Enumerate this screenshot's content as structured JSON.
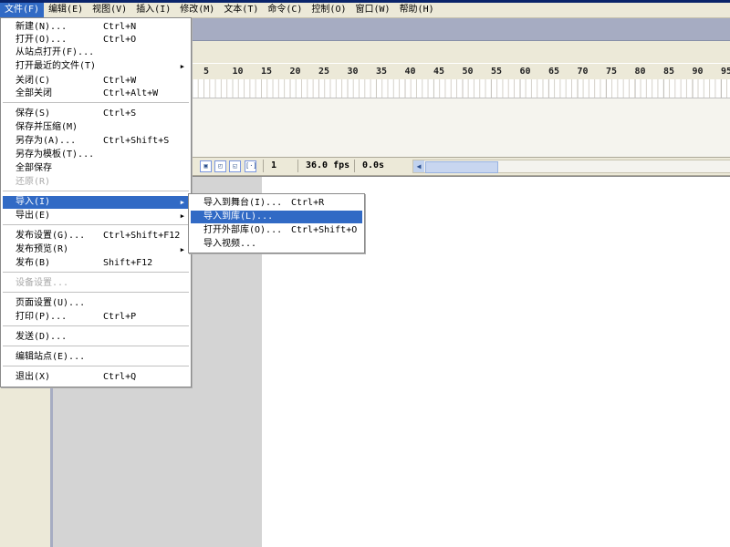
{
  "menubar": [
    {
      "label": "文件(F)",
      "active": true
    },
    {
      "label": "编辑(E)"
    },
    {
      "label": "视图(V)"
    },
    {
      "label": "插入(I)"
    },
    {
      "label": "修改(M)"
    },
    {
      "label": "文本(T)"
    },
    {
      "label": "命令(C)"
    },
    {
      "label": "控制(O)"
    },
    {
      "label": "窗口(W)"
    },
    {
      "label": "帮助(H)"
    }
  ],
  "file_menu": {
    "items": [
      {
        "label": "新建(N)...",
        "shortcut": "Ctrl+N"
      },
      {
        "label": "打开(O)...",
        "shortcut": "Ctrl+O"
      },
      {
        "label": "从站点打开(F)...",
        "shortcut": ""
      },
      {
        "label": "打开最近的文件(T)",
        "shortcut": "",
        "submenu": true
      },
      {
        "label": "关闭(C)",
        "shortcut": "Ctrl+W"
      },
      {
        "label": "全部关闭",
        "shortcut": "Ctrl+Alt+W"
      },
      {
        "label": "保存(S)",
        "shortcut": "Ctrl+S"
      },
      {
        "label": "保存并压缩(M)",
        "shortcut": ""
      },
      {
        "label": "另存为(A)...",
        "shortcut": "Ctrl+Shift+S"
      },
      {
        "label": "另存为模板(T)...",
        "shortcut": ""
      },
      {
        "label": "全部保存",
        "shortcut": ""
      },
      {
        "label": "还原(R)",
        "shortcut": "",
        "disabled": true
      },
      {
        "label": "导入(I)",
        "shortcut": "",
        "submenu": true,
        "highlighted": true
      },
      {
        "label": "导出(E)",
        "shortcut": "",
        "submenu": true
      },
      {
        "label": "发布设置(G)...",
        "shortcut": "Ctrl+Shift+F12"
      },
      {
        "label": "发布预览(R)",
        "shortcut": "",
        "submenu": true
      },
      {
        "label": "发布(B)",
        "shortcut": "Shift+F12"
      },
      {
        "label": "设备设置...",
        "shortcut": "",
        "disabled": true
      },
      {
        "label": "页面设置(U)...",
        "shortcut": ""
      },
      {
        "label": "打印(P)...",
        "shortcut": "Ctrl+P"
      },
      {
        "label": "发送(D)...",
        "shortcut": ""
      },
      {
        "label": "编辑站点(E)...",
        "shortcut": ""
      },
      {
        "label": "退出(X)",
        "shortcut": "Ctrl+Q"
      }
    ]
  },
  "import_menu": {
    "items": [
      {
        "label": "导入到舞台(I)...",
        "shortcut": "Ctrl+R"
      },
      {
        "label": "导入到库(L)...",
        "shortcut": "",
        "highlighted": true
      },
      {
        "label": "打开外部库(O)...",
        "shortcut": "Ctrl+Shift+O"
      },
      {
        "label": "导入视频...",
        "shortcut": ""
      }
    ]
  },
  "timeline": {
    "ruler_numbers": [
      "5",
      "10",
      "15",
      "20",
      "25",
      "30",
      "35",
      "40",
      "45",
      "50",
      "55",
      "60",
      "65",
      "70",
      "75",
      "80",
      "85",
      "90",
      "95"
    ],
    "current_frame": "1",
    "frame_rate": "36.0 fps",
    "elapsed_time": "0.0s"
  },
  "colors": {
    "menu_highlight": "#316ac5",
    "menubar_bg": "#ece9d8",
    "timeline_header": "#a6acc2",
    "pasteboard": "#d4d4d4"
  }
}
